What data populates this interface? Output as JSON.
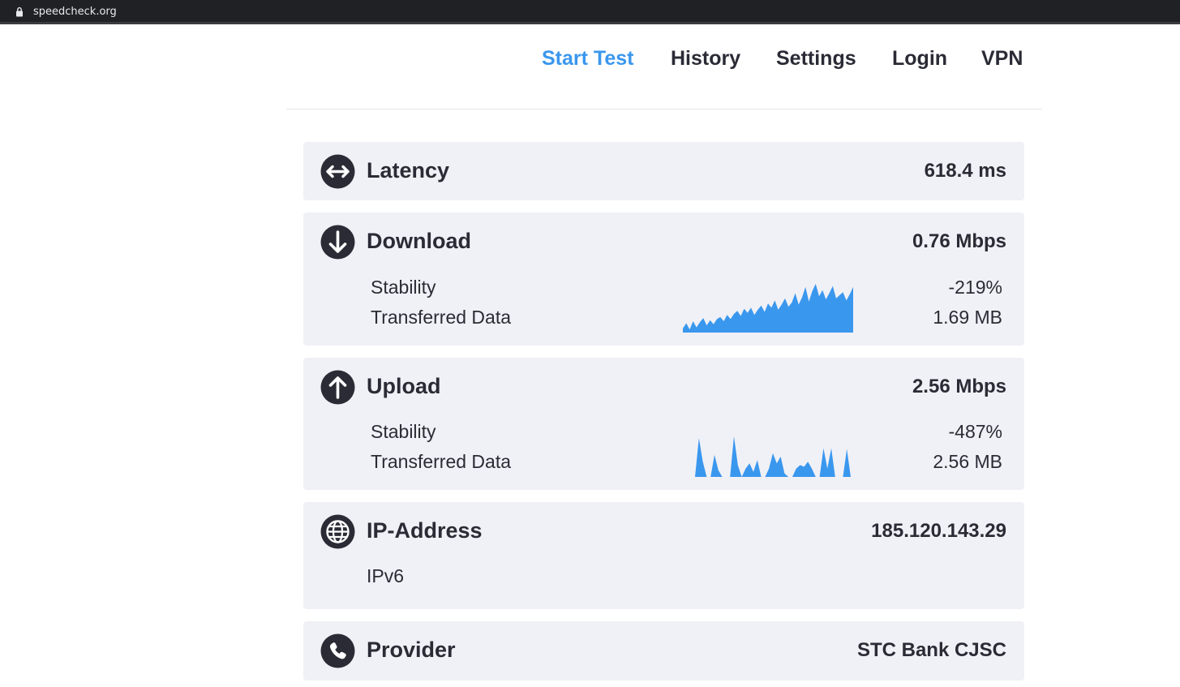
{
  "browser": {
    "url": "speedcheck.org"
  },
  "nav": [
    "Start Test",
    "History",
    "Settings",
    "Login",
    "VPN"
  ],
  "accent": "#3a97ee",
  "latency": {
    "icon": "arrows-horizontal-icon",
    "label": "Latency",
    "value": "618.4 ms"
  },
  "download": {
    "icon": "arrow-down-icon",
    "label": "Download",
    "value": "0.76 Mbps",
    "stability_label": "Stability",
    "stability_value": "-219%",
    "transferred_label": "Transferred Data",
    "transferred_value": "1.69 MB",
    "graph": [
      4,
      9,
      3,
      11,
      5,
      10,
      14,
      7,
      12,
      8,
      13,
      15,
      11,
      17,
      13,
      18,
      21,
      16,
      23,
      19,
      24,
      17,
      22,
      26,
      20,
      28,
      24,
      31,
      22,
      27,
      33,
      25,
      29,
      38,
      27,
      34,
      44,
      30,
      40,
      47,
      35,
      41,
      32,
      38,
      45,
      33,
      36,
      39,
      31,
      37,
      44
    ]
  },
  "upload": {
    "icon": "arrow-up-icon",
    "label": "Upload",
    "value": "2.56 Mbps",
    "stability_label": "Stability",
    "stability_value": "-487%",
    "transferred_label": "Transferred Data",
    "transferred_value": "2.56 MB",
    "graph": [
      0,
      46,
      18,
      0,
      0,
      26,
      8,
      0,
      0,
      0,
      48,
      14,
      0,
      10,
      16,
      6,
      20,
      0,
      0,
      10,
      28,
      16,
      24,
      4,
      0,
      0,
      10,
      14,
      12,
      18,
      10,
      0,
      0,
      34,
      10,
      34,
      0,
      0,
      0,
      33,
      0
    ]
  },
  "ip": {
    "icon": "globe-icon",
    "label": "IP-Address",
    "value": "185.120.143.29",
    "version": "IPv6"
  },
  "provider": {
    "icon": "phone-icon",
    "label": "Provider",
    "value": "STC Bank CJSC"
  }
}
